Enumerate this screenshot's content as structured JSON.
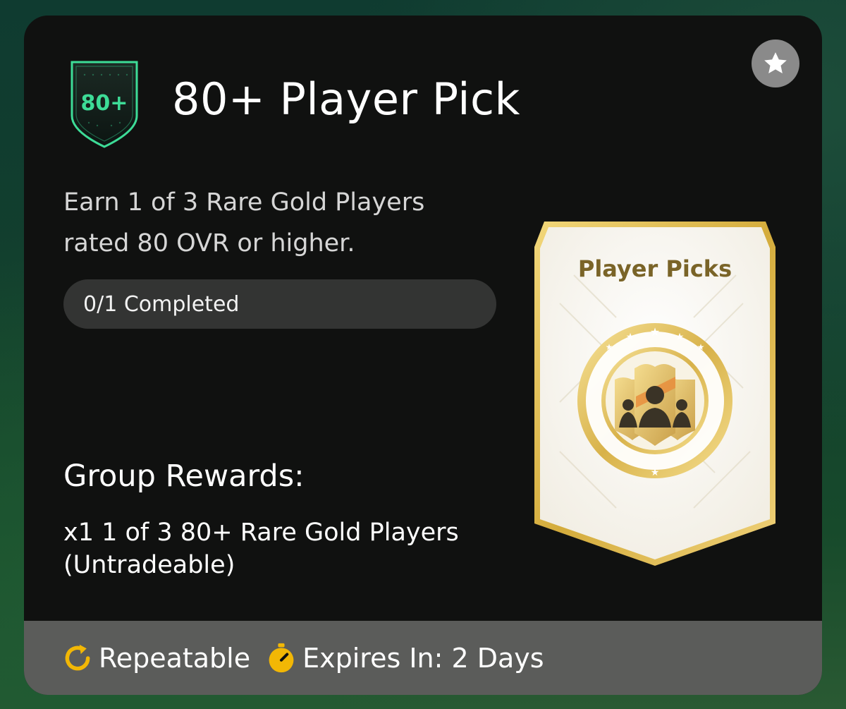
{
  "header": {
    "badge_text": "80+",
    "title": "80+ Player Pick"
  },
  "description": {
    "line1": "Earn 1 of 3 Rare Gold Players",
    "line2": "rated 80 OVR or higher."
  },
  "progress": {
    "label": "0/1 Completed",
    "completed": 0,
    "total": 1
  },
  "rewards": {
    "heading": "Group Rewards:",
    "item_line1": "x1 1 of 3 80+ Rare Gold Players",
    "item_line2": "(Untradeable)"
  },
  "pack": {
    "title": "Player Picks"
  },
  "footer": {
    "repeatable": "Repeatable",
    "expires": "Expires In: 2 Days"
  },
  "icons": {
    "favorite": "star-icon",
    "repeat": "repeat-icon",
    "timer": "stopwatch-icon"
  },
  "colors": {
    "accent_green": "#3ddc97",
    "gold": "#d6b24a",
    "timer_yellow": "#f2b705",
    "card_bg": "#101110",
    "footer_bg": "#5b5c5a"
  }
}
